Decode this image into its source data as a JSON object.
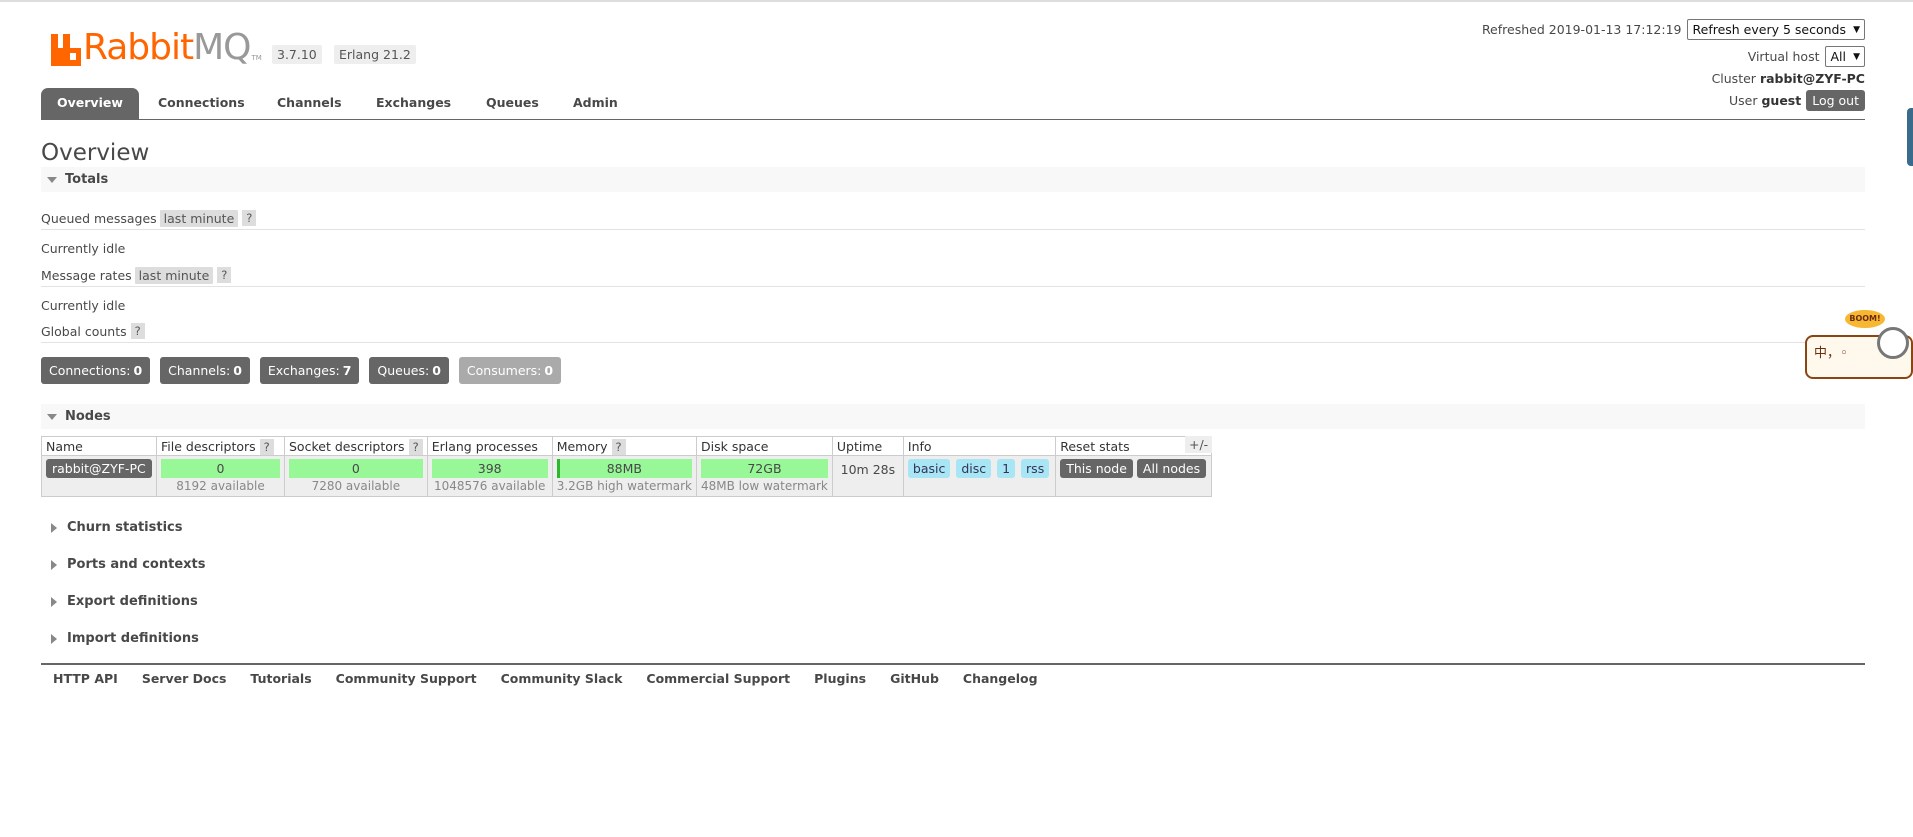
{
  "header": {
    "logo_main": "Rabbit",
    "logo_mq": "MQ",
    "logo_tm": "TM",
    "version": "3.7.10",
    "erlang": "Erlang 21.2",
    "refreshed_label": "Refreshed 2019-01-13 17:12:19",
    "refresh_select": "Refresh every 5 seconds",
    "virtual_host_label": "Virtual host",
    "virtual_host_value": "All",
    "cluster_label": "Cluster",
    "cluster_value": "rabbit@ZYF-PC",
    "user_label": "User",
    "user_value": "guest",
    "logout_label": "Log out"
  },
  "tabs": [
    "Overview",
    "Connections",
    "Channels",
    "Exchanges",
    "Queues",
    "Admin"
  ],
  "page_title": "Overview",
  "totals": {
    "section_label": "Totals",
    "queued_messages_label": "Queued messages",
    "queued_messages_range": "last minute",
    "queued_status": "Currently idle",
    "message_rates_label": "Message rates",
    "message_rates_range": "last minute",
    "rates_status": "Currently idle",
    "global_counts_label": "Global counts",
    "help": "?"
  },
  "counts": [
    {
      "label": "Connections:",
      "value": "0"
    },
    {
      "label": "Channels:",
      "value": "0"
    },
    {
      "label": "Exchanges:",
      "value": "7"
    },
    {
      "label": "Queues:",
      "value": "0"
    },
    {
      "label": "Consumers:",
      "value": "0"
    }
  ],
  "nodes": {
    "section_label": "Nodes",
    "columns": [
      "Name",
      "File descriptors",
      "Socket descriptors",
      "Erlang processes",
      "Memory",
      "Disk space",
      "Uptime",
      "Info",
      "Reset stats"
    ],
    "plus_minus": "+/-",
    "row": {
      "name": "rabbit@ZYF-PC",
      "file_descriptors": "0",
      "file_descriptors_sub": "8192 available",
      "socket_descriptors": "0",
      "socket_descriptors_sub": "7280 available",
      "erlang_processes": "398",
      "erlang_processes_sub": "1048576 available",
      "memory": "88MB",
      "memory_sub": "3.2GB high watermark",
      "disk_space": "72GB",
      "disk_space_sub": "48MB low watermark",
      "uptime": "10m 28s",
      "info": [
        "basic",
        "disc",
        "1",
        "rss"
      ],
      "reset_this": "This node",
      "reset_all": "All nodes"
    }
  },
  "collapsed_sections": [
    "Churn statistics",
    "Ports and contexts",
    "Export definitions",
    "Import definitions"
  ],
  "footer": [
    "HTTP API",
    "Server Docs",
    "Tutorials",
    "Community Support",
    "Community Slack",
    "Commercial Support",
    "Plugins",
    "GitHub",
    "Changelog"
  ],
  "widget": {
    "boom": "BOOM!",
    "chars": "中，◦"
  },
  "colors": {
    "brand_orange": "#ff6600",
    "tab_dark": "#666666",
    "bar_green": "#98f898",
    "info_blue": "#a8e5f5"
  }
}
